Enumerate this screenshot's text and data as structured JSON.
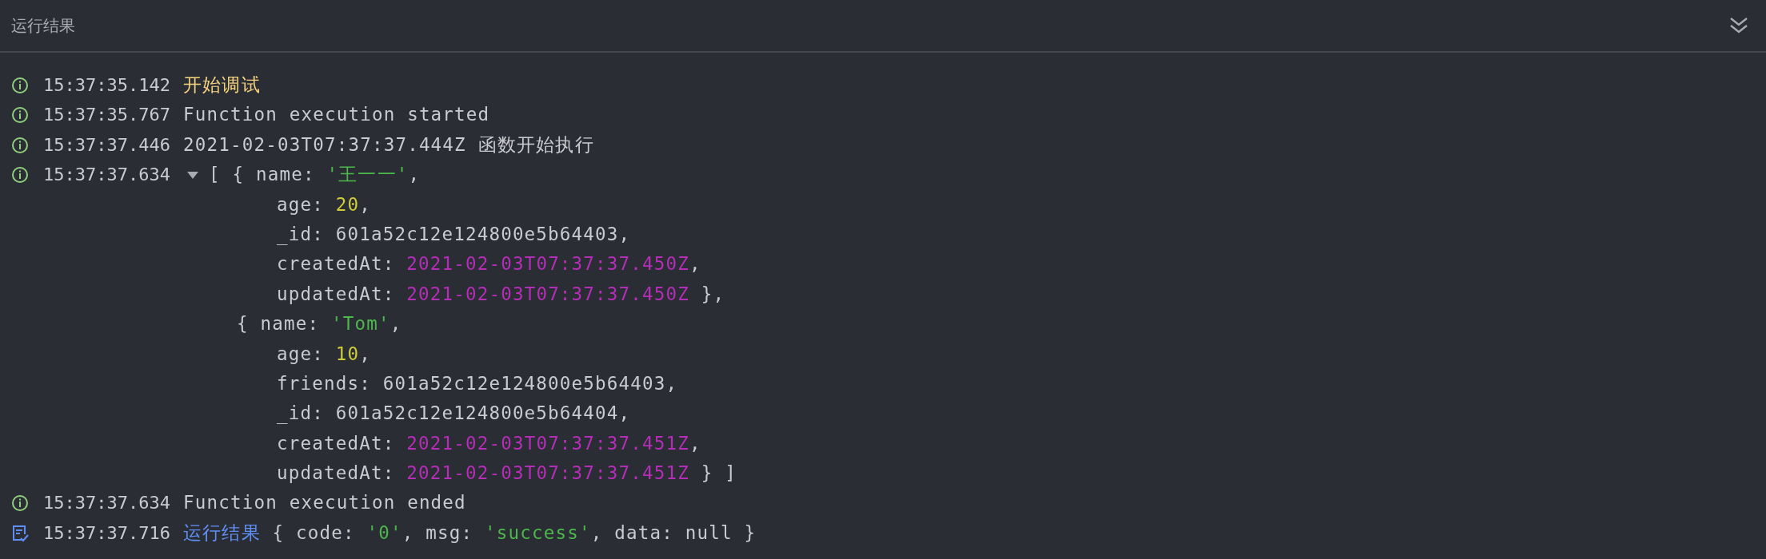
{
  "panel": {
    "title": "运行结果"
  },
  "log": [
    {
      "kind": "info",
      "time": "15:37:35.142",
      "lines": [
        {
          "kind": "first",
          "tokens": [
            {
              "text": "开始调试",
              "kind": "notice"
            }
          ]
        }
      ]
    },
    {
      "kind": "info",
      "time": "15:37:35.767",
      "lines": [
        {
          "kind": "first",
          "tokens": [
            {
              "text": "Function execution started",
              "kind": "plain"
            }
          ]
        }
      ]
    },
    {
      "kind": "info",
      "time": "15:37:37.446",
      "lines": [
        {
          "kind": "first",
          "tokens": [
            {
              "text": "2021-02-03T07:37:37.444Z 函数开始执行",
              "kind": "plain"
            }
          ]
        }
      ]
    },
    {
      "kind": "info",
      "time": "15:37:37.634",
      "expanded": true,
      "lines": [
        {
          "kind": "first",
          "tokens": [
            {
              "text": "[ { name: ",
              "kind": "plain"
            },
            {
              "text": "'王一一'",
              "kind": "string"
            },
            {
              "text": ",",
              "kind": "plain"
            }
          ]
        },
        {
          "kind": "field",
          "tokens": [
            {
              "text": "age: ",
              "kind": "plain"
            },
            {
              "text": "20",
              "kind": "number"
            },
            {
              "text": ",",
              "kind": "plain"
            }
          ]
        },
        {
          "kind": "field",
          "tokens": [
            {
              "text": "_id: 601a52c12e124800e5b64403,",
              "kind": "plain"
            }
          ]
        },
        {
          "kind": "field",
          "tokens": [
            {
              "text": "createdAt: ",
              "kind": "plain"
            },
            {
              "text": "2021-02-03T07:37:37.450Z",
              "kind": "date"
            },
            {
              "text": ",",
              "kind": "plain"
            }
          ]
        },
        {
          "kind": "field",
          "tokens": [
            {
              "text": "updatedAt: ",
              "kind": "plain"
            },
            {
              "text": "2021-02-03T07:37:37.450Z",
              "kind": "date"
            },
            {
              "text": " },",
              "kind": "plain"
            }
          ]
        },
        {
          "kind": "object",
          "tokens": [
            {
              "text": "{ name: ",
              "kind": "plain"
            },
            {
              "text": "'Tom'",
              "kind": "string"
            },
            {
              "text": ",",
              "kind": "plain"
            }
          ]
        },
        {
          "kind": "field",
          "tokens": [
            {
              "text": "age: ",
              "kind": "plain"
            },
            {
              "text": "10",
              "kind": "number"
            },
            {
              "text": ",",
              "kind": "plain"
            }
          ]
        },
        {
          "kind": "field",
          "tokens": [
            {
              "text": "friends: 601a52c12e124800e5b64403,",
              "kind": "plain"
            }
          ]
        },
        {
          "kind": "field",
          "tokens": [
            {
              "text": "_id: 601a52c12e124800e5b64404,",
              "kind": "plain"
            }
          ]
        },
        {
          "kind": "field",
          "tokens": [
            {
              "text": "createdAt: ",
              "kind": "plain"
            },
            {
              "text": "2021-02-03T07:37:37.451Z",
              "kind": "date"
            },
            {
              "text": ",",
              "kind": "plain"
            }
          ]
        },
        {
          "kind": "field",
          "tokens": [
            {
              "text": "updatedAt: ",
              "kind": "plain"
            },
            {
              "text": "2021-02-03T07:37:37.451Z",
              "kind": "date"
            },
            {
              "text": " } ]",
              "kind": "plain"
            }
          ]
        }
      ]
    },
    {
      "kind": "info",
      "time": "15:37:37.634",
      "lines": [
        {
          "kind": "first",
          "tokens": [
            {
              "text": "Function execution ended",
              "kind": "plain"
            }
          ]
        }
      ]
    },
    {
      "kind": "result",
      "time": "15:37:37.716",
      "lines": [
        {
          "kind": "first",
          "tokens": [
            {
              "text": "运行结果",
              "kind": "label"
            },
            {
              "text": " { code: ",
              "kind": "plain"
            },
            {
              "text": "'0'",
              "kind": "string"
            },
            {
              "text": ", msg: ",
              "kind": "plain"
            },
            {
              "text": "'success'",
              "kind": "string"
            },
            {
              "text": ", data: null }",
              "kind": "plain"
            }
          ]
        }
      ]
    }
  ]
}
